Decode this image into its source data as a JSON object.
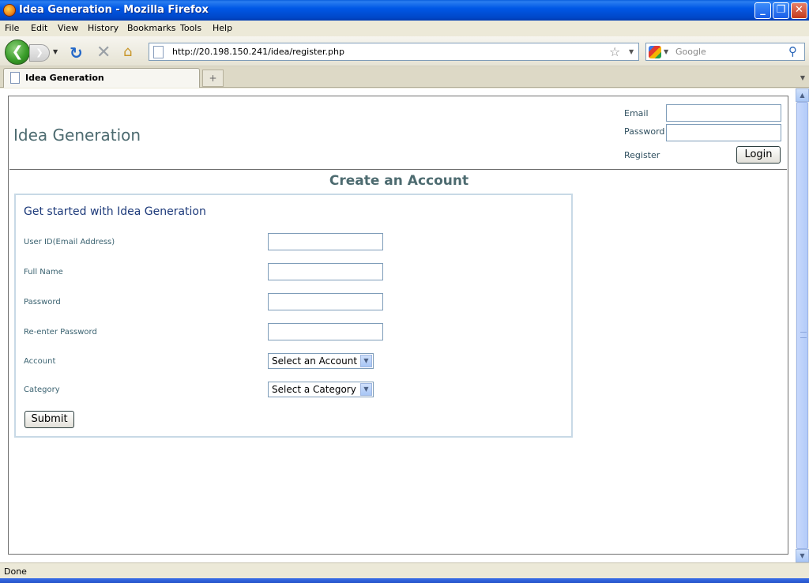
{
  "window": {
    "title": "Idea Generation - Mozilla Firefox"
  },
  "menu": [
    "File",
    "Edit",
    "View",
    "History",
    "Bookmarks",
    "Tools",
    "Help"
  ],
  "nav": {
    "url": "http://20.198.150.241/idea/register.php",
    "search_placeholder": "Google"
  },
  "tab": {
    "label": "Idea Generation"
  },
  "header": {
    "site_title": "Idea Generation",
    "email_label": "Email",
    "password_label": "Password",
    "register_label": "Register",
    "login_label": "Login"
  },
  "form": {
    "section_title": "Create an Account",
    "heading": "Get started with Idea Generation",
    "fields": [
      {
        "label": "User ID(Email Address)"
      },
      {
        "label": "Full Name"
      },
      {
        "label": "Password"
      },
      {
        "label": "Re-enter Password"
      }
    ],
    "account": {
      "label": "Account",
      "selected": "Select an Account"
    },
    "category": {
      "label": "Category",
      "selected": "Select a Category"
    },
    "submit_label": "Submit"
  },
  "status": {
    "text": "Done"
  },
  "colors": {
    "title_text": "#4d6b70",
    "form_border": "#c8d9e6",
    "titlebar": "#0058e6"
  }
}
